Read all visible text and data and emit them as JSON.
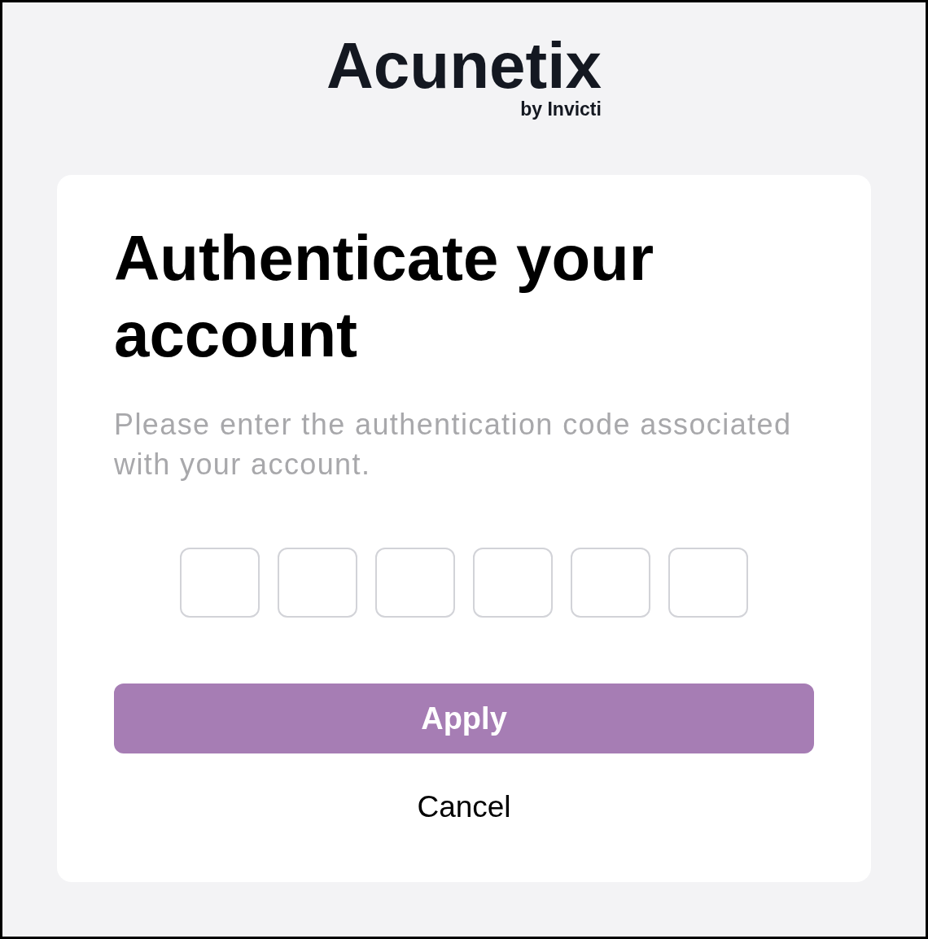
{
  "logo": {
    "name": "Acunetix",
    "tagline": "by Invicti"
  },
  "card": {
    "title": "Authenticate your account",
    "description": "Please enter the authentication code associated with your account.",
    "code_fields": [
      {
        "focused": false
      },
      {
        "focused": false
      },
      {
        "focused": false
      },
      {
        "focused": false
      },
      {
        "focused": false
      },
      {
        "focused": false
      }
    ],
    "apply_button": {
      "label": "Apply",
      "disabled": true
    },
    "cancel_link": {
      "label": "Cancel"
    }
  }
}
